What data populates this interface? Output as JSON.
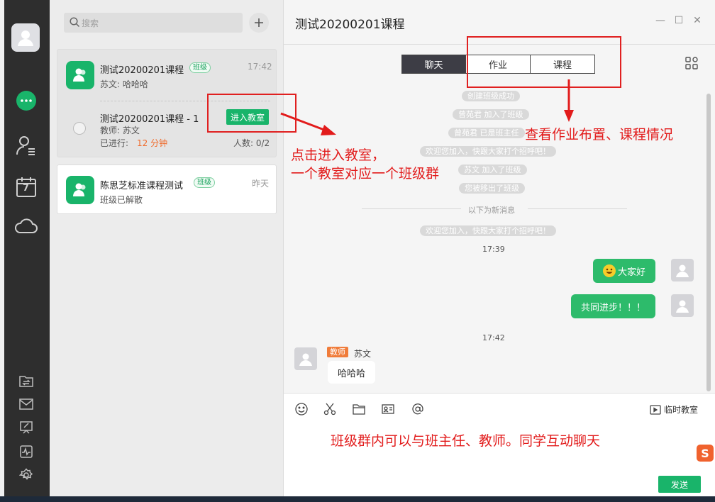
{
  "sidebar": {
    "icons": [
      "avatar",
      "chat-bubble-icon",
      "contacts-icon",
      "calendar-icon",
      "cloud-icon",
      "file-transfer-icon",
      "mail-icon",
      "whiteboard-icon",
      "activity-icon",
      "settings-icon"
    ],
    "calendar_day": "7",
    "accent": "#19b46a"
  },
  "search": {
    "placeholder": "搜索"
  },
  "sessions": [
    {
      "title": "测试20200201课程",
      "badge": "班级",
      "time": "17:42",
      "preview": "苏文: 哈哈哈",
      "sub_title": "测试20200201课程 - 1",
      "enter_label": "进入教室",
      "teacher": "教师: 苏文",
      "ongoing_label": "已进行:",
      "ongoing_value": "12 分钟",
      "count": "人数: 0/2"
    },
    {
      "title": "陈思芝标准课程测试",
      "badge": "班级",
      "time": "昨天",
      "preview": "班级已解散"
    }
  ],
  "chat": {
    "title": "测试20200201课程",
    "tabs": [
      "聊天",
      "作业",
      "课程"
    ],
    "active_tab": "聊天",
    "system_messages": [
      "创建班级成功",
      "曾苑君 加入了班级",
      "曾苑君 已是班主任",
      "欢迎您加入，快跟大家打个招呼吧！",
      "苏文 加入了班级",
      "您被移出了班级"
    ],
    "new_messages_label": "以下为新消息",
    "system_after_divider": "欢迎您加入，快跟大家打个招呼吧！",
    "time1": "17:39",
    "my_msg1": "大家好",
    "my_msg2": "共同进步！！！",
    "time2": "17:42",
    "teacher_tag": "教师",
    "teacher_name": "苏文",
    "teacher_msg": "哈哈哈",
    "temp_class_label": "临时教室",
    "send_label": "发送"
  },
  "annotations": {
    "enter_line1": "点击进入教室，",
    "enter_line2": "一个教室对应一个班级群",
    "tabs_note": "查看作业布置、课程情况",
    "chat_note": "班级群内可以与班主任、教师。同学互动聊天"
  }
}
